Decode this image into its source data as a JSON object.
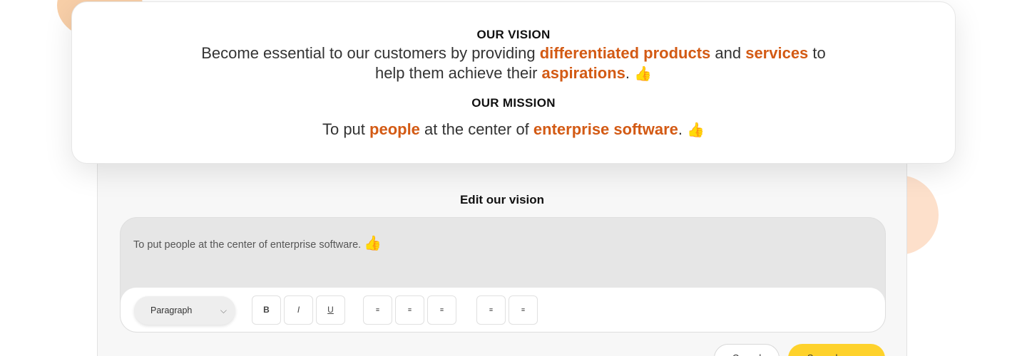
{
  "vision": {
    "heading": "OUR VISION",
    "parts": [
      "Become essential to our customers by providing ",
      "differentiated products",
      " and ",
      "services",
      " to help them achieve their ",
      "aspirations",
      ". "
    ],
    "emoji": "👍"
  },
  "mission": {
    "heading": "OUR MISSION",
    "parts": [
      "To put ",
      "people",
      " at the center of ",
      "enterprise software",
      ". "
    ],
    "emoji": "👍"
  },
  "editor": {
    "title": "Edit our vision",
    "content": "To put people at the center of enterprise software.",
    "emoji": "👍",
    "paragraph_select": "Paragraph",
    "toolbar": {
      "bold": "B",
      "italic": "I",
      "underline": "U",
      "align_left": "≡",
      "align_center": "≡",
      "align_right": "≡",
      "bullet_list": "≡",
      "numbered_list": "≡"
    },
    "cancel_label": "Cancel",
    "save_label": "Save changes"
  },
  "colors": {
    "highlight": "#d35a14",
    "save_button": "#fed22c",
    "blob": "#f8cfa8"
  },
  "icons": {
    "thumbs_up": "thumbs-up-icon",
    "chevron": "chevron-down-icon"
  }
}
